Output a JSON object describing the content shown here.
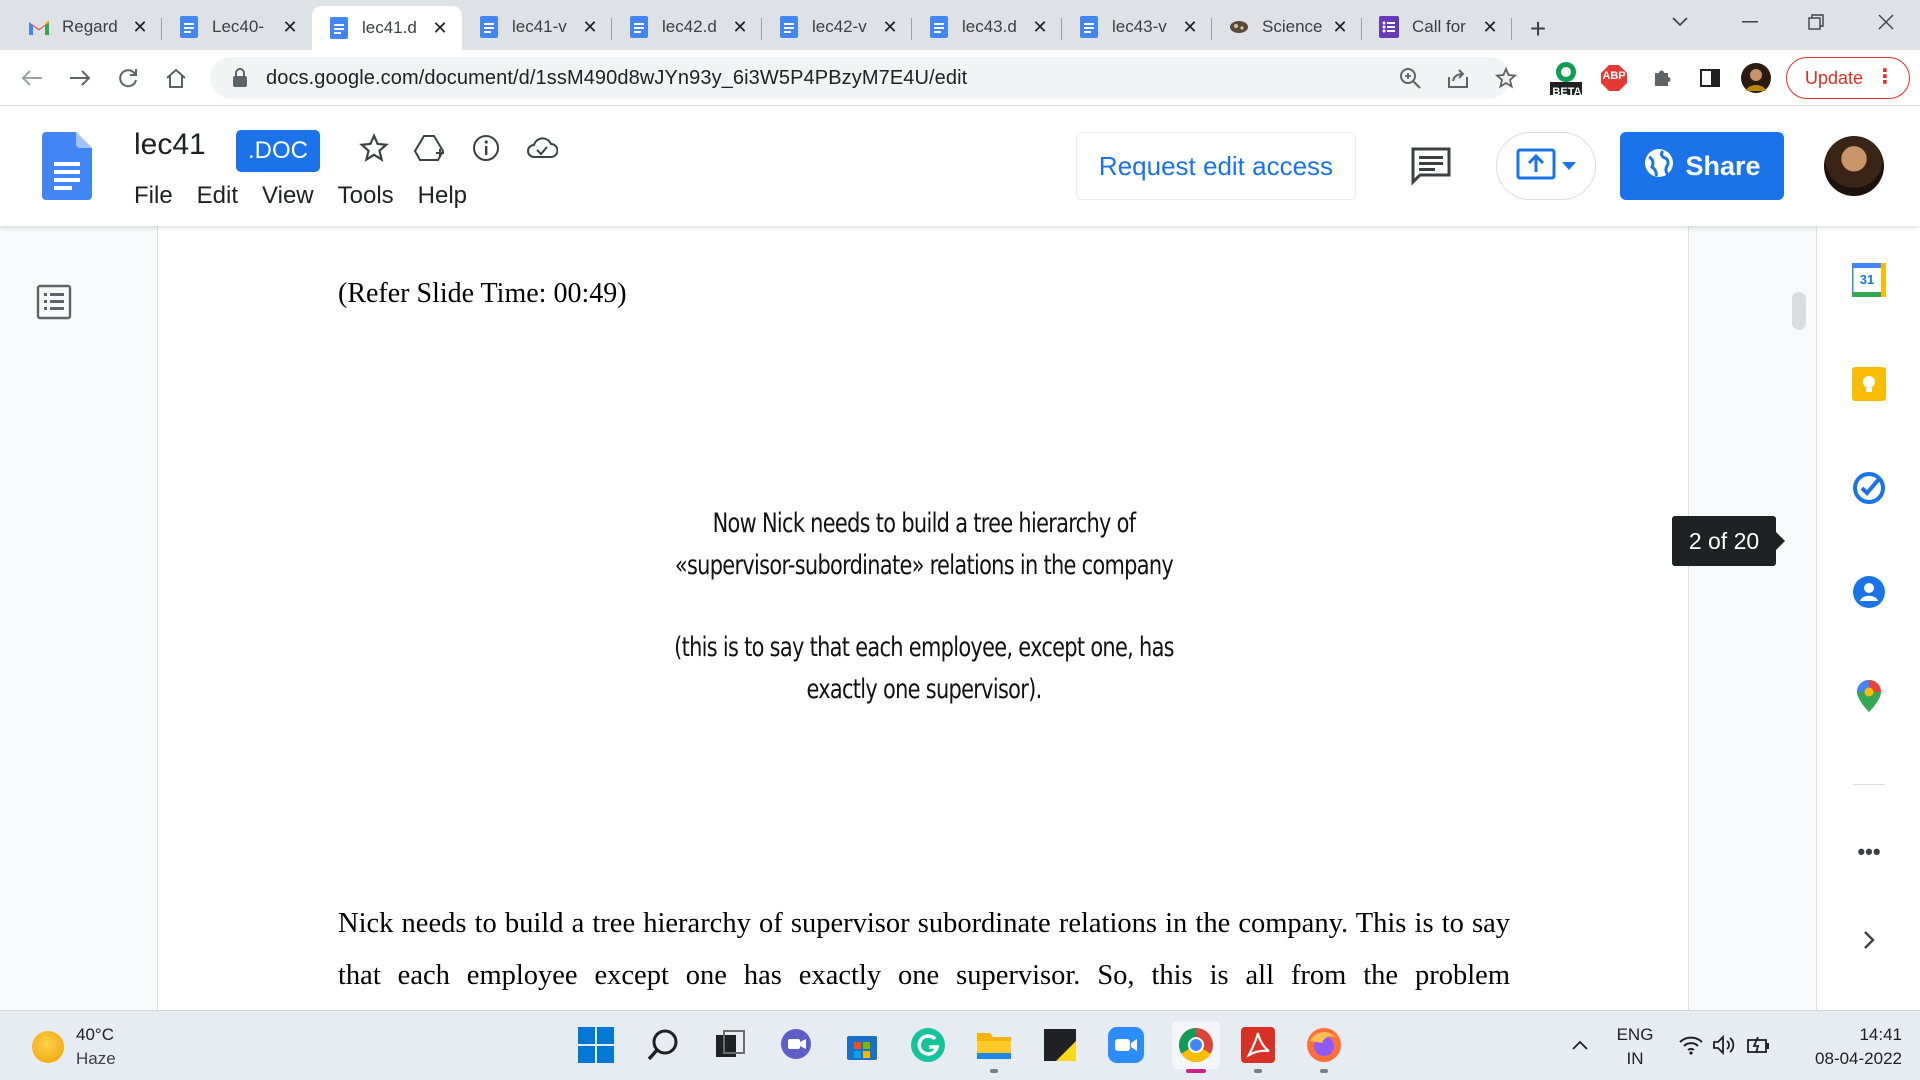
{
  "browser": {
    "tabs": [
      {
        "title": "Regard",
        "icon": "gmail-icon"
      },
      {
        "title": "Lec40-",
        "icon": "docs-icon"
      },
      {
        "title": "lec41.d",
        "icon": "docs-icon",
        "active": true
      },
      {
        "title": "lec41-v",
        "icon": "docs-icon"
      },
      {
        "title": "lec42.d",
        "icon": "docs-icon"
      },
      {
        "title": "lec42-v",
        "icon": "docs-icon"
      },
      {
        "title": "lec43.d",
        "icon": "docs-icon"
      },
      {
        "title": "lec43-v",
        "icon": "docs-icon"
      },
      {
        "title": "Science",
        "icon": "science-icon"
      },
      {
        "title": "Call for",
        "icon": "forms-icon"
      }
    ],
    "url": "docs.google.com/document/d/1ssM490d8wJYn93y_6i3W5P4PBzyM7E4U/edit",
    "extension_badge": "BETA",
    "abp_label": "ABP",
    "update_label": "Update"
  },
  "docs": {
    "title": "lec41",
    "badge": ".DOC",
    "menu": [
      "File",
      "Edit",
      "View",
      "Tools",
      "Help"
    ],
    "request_edit_label": "Request edit access",
    "share_label": "Share"
  },
  "document": {
    "refer_line": "(Refer Slide Time: 00:49)",
    "slide_lines": [
      "Now Nick needs to build a tree hierarchy of",
      "«supervisor-subordinate» relations in the company",
      "(this is to say that each employee, except one, has",
      "exactly one supervisor)."
    ],
    "body": "Nick needs to build a tree hierarchy of supervisor subordinate relations in the company. This is to say that each employee except one has exactly one supervisor. So, this is all from the problem",
    "page_indicator": "2 of 20"
  },
  "side_panel": {
    "calendar_day": "31"
  },
  "taskbar": {
    "weather_temp": "40°C",
    "weather_desc": "Haze",
    "lang_top": "ENG",
    "lang_bottom": "IN",
    "time": "14:41",
    "date": "08-04-2022"
  },
  "colors": {
    "accent": "#1a73e8",
    "update": "#d93025",
    "tabstrip": "#dee1e6"
  }
}
